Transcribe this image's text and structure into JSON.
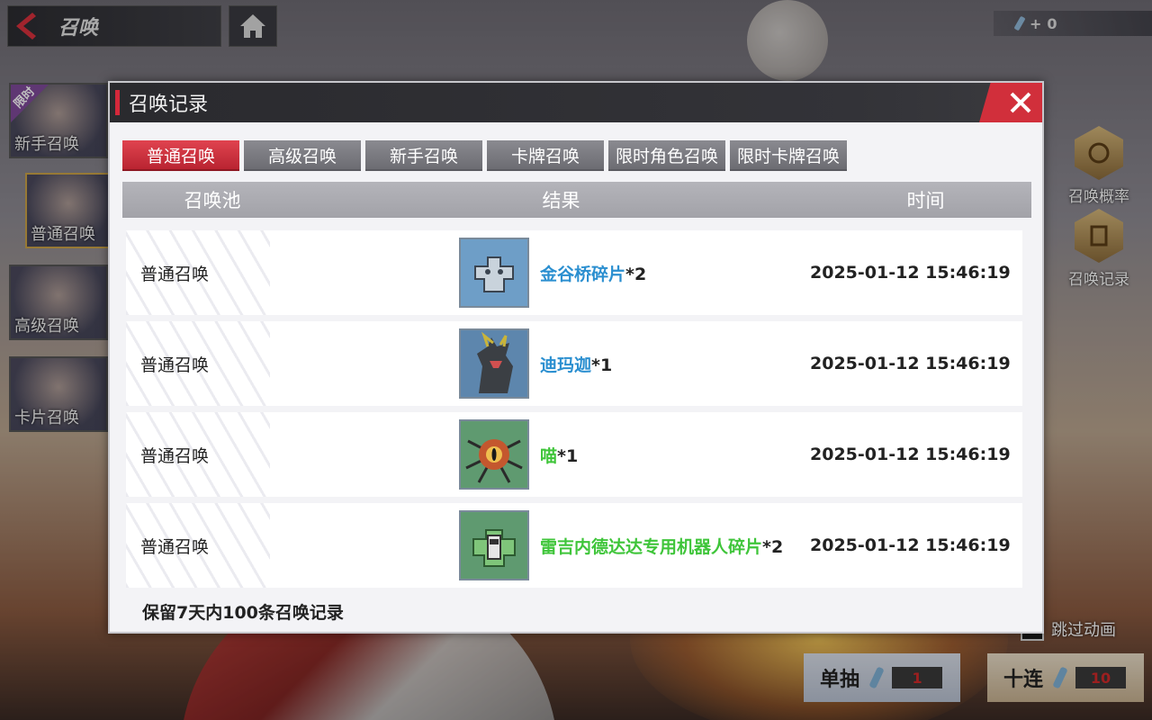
{
  "topbar": {
    "title": "召唤",
    "currency_amount": "0"
  },
  "side_tabs": [
    {
      "label": "新手召唤",
      "badge": "限时"
    },
    {
      "label": "普通召唤"
    },
    {
      "label": "高级召唤"
    },
    {
      "label": "卡片召唤"
    }
  ],
  "side_right": [
    {
      "label": "召唤概率"
    },
    {
      "label": "召唤记录"
    }
  ],
  "bottom": {
    "skip_label": "跳过动画",
    "single_label": "单抽",
    "single_cost": "1",
    "ten_label": "十连",
    "ten_cost": "10"
  },
  "modal": {
    "title": "召唤记录",
    "tabs": [
      {
        "label": "普通召唤",
        "active": true
      },
      {
        "label": "高级召唤"
      },
      {
        "label": "新手召唤"
      },
      {
        "label": "卡牌召唤"
      },
      {
        "label": "限时角色召唤"
      },
      {
        "label": "限时卡牌召唤"
      }
    ],
    "columns": {
      "pool": "召唤池",
      "result": "结果",
      "time": "时间"
    },
    "rows": [
      {
        "pool": "普通召唤",
        "item": "金谷桥碎片",
        "qty": "*2",
        "time": "2025-01-12 15:46:19",
        "rarity_color": "#2b8fd0",
        "icon": "robot-fragment-icon",
        "bg": "#6e9ec7"
      },
      {
        "pool": "普通召唤",
        "item": "迪玛迦",
        "qty": "*1",
        "time": "2025-01-12 15:46:19",
        "rarity_color": "#2b8fd0",
        "icon": "kaiju-icon",
        "bg": "#5d86ad"
      },
      {
        "pool": "普通召唤",
        "item": "喵",
        "qty": "*1",
        "time": "2025-01-12 15:46:19",
        "rarity_color": "#3fc53a",
        "icon": "eyeball-monster-icon",
        "bg": "#5f9a70"
      },
      {
        "pool": "普通召唤",
        "item": "雷吉内德达达专用机器人碎片",
        "qty": "*2",
        "time": "2025-01-12 15:46:19",
        "rarity_color": "#3fc53a",
        "icon": "robot-fragment-icon",
        "bg": "#5f9a70"
      }
    ],
    "footer": "保留7天内100条召唤记录"
  },
  "colors": {
    "accent_red": "#d4283a",
    "rare_blue": "#2b8fd0",
    "common_green": "#3fc53a"
  }
}
